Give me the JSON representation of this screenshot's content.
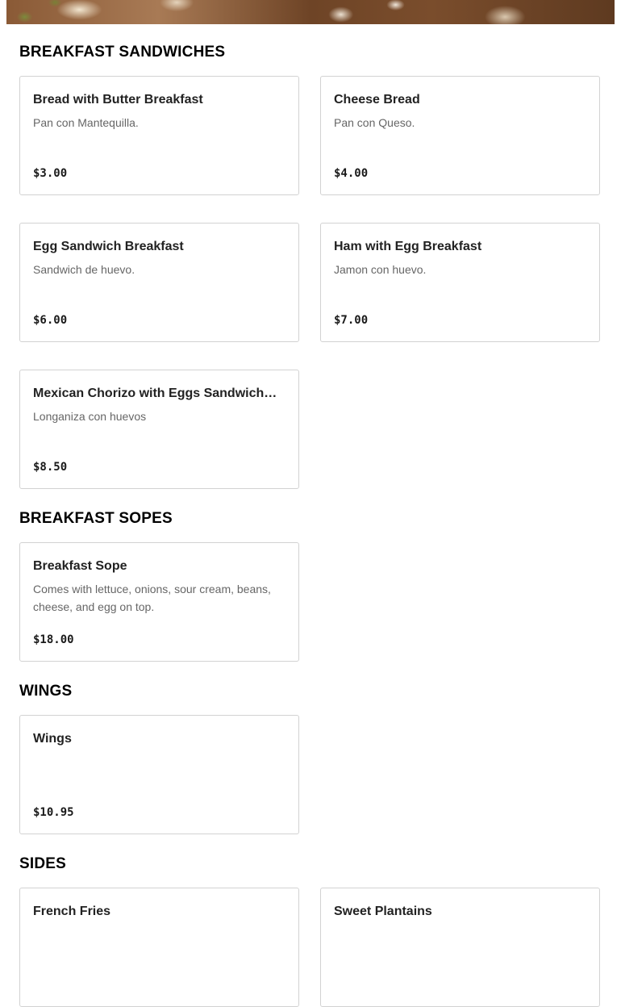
{
  "sections": [
    {
      "title": "BREAKFAST SANDWICHES",
      "items": [
        {
          "name": "Bread with Butter Breakfast",
          "description": "Pan con Mantequilla.",
          "price": "$3.00"
        },
        {
          "name": "Cheese Bread",
          "description": "Pan con Queso.",
          "price": "$4.00"
        },
        {
          "name": "Egg Sandwich Breakfast",
          "description": "Sandwich de huevo.",
          "price": "$6.00"
        },
        {
          "name": "Ham with Egg Breakfast",
          "description": "Jamon con huevo.",
          "price": "$7.00"
        },
        {
          "name": "Mexican Chorizo with Eggs Sandwich…",
          "description": "Longaniza con huevos",
          "price": "$8.50"
        }
      ]
    },
    {
      "title": "BREAKFAST SOPES",
      "items": [
        {
          "name": "Breakfast Sope",
          "description": "Comes with lettuce, onions, sour cream, beans, cheese, and egg on top.",
          "price": "$18.00"
        }
      ]
    },
    {
      "title": "WINGS",
      "items": [
        {
          "name": "Wings",
          "description": "",
          "price": "$10.95"
        }
      ]
    },
    {
      "title": "SIDES",
      "items": [
        {
          "name": "French Fries",
          "description": "",
          "price": ""
        },
        {
          "name": "Sweet Plantains",
          "description": "",
          "price": ""
        }
      ]
    }
  ]
}
